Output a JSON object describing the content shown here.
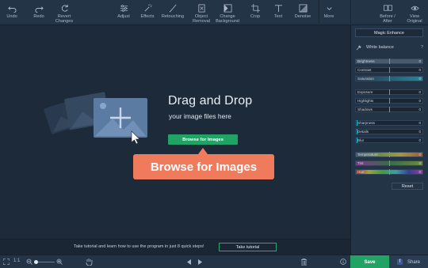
{
  "toolbar": {
    "undo": "Undo",
    "redo": "Redo",
    "revert_line1": "Revert",
    "revert_line2": "Changes",
    "adjust": "Adjust",
    "effects": "Effects",
    "retouching": "Retouching",
    "object_line1": "Object",
    "object_line2": "Removal",
    "change_line1": "Change",
    "change_line2": "Background",
    "crop": "Crop",
    "text": "Text",
    "denoise": "Denoise",
    "more": "More",
    "before_line1": "Before /",
    "before_line2": "After",
    "view_line1": "View",
    "view_line2": "Original"
  },
  "canvas": {
    "title": "Drag and Drop",
    "subtitle": "your image files here",
    "browse_button": "Browse for Images",
    "callout": "Browse for Images"
  },
  "tutorial": {
    "text": "Take tutorial and learn how to use the program in just 8 quick steps!",
    "button": "Take tutorial"
  },
  "bottombar": {
    "zoom_label": "1:1",
    "save": "Save",
    "share": "Share"
  },
  "panel": {
    "magic_enhance": "Magic Enhance",
    "white_balance": "White balance",
    "help": "?",
    "reset": "Reset",
    "sliders": [
      {
        "label": "Brightness",
        "value": "0"
      },
      {
        "label": "Contrast",
        "value": "0"
      },
      {
        "label": "Saturation",
        "value": "0"
      },
      {
        "label": "Exposure",
        "value": "0"
      },
      {
        "label": "Highlights",
        "value": "0"
      },
      {
        "label": "Shadows",
        "value": "0"
      },
      {
        "label": "Sharpness",
        "value": "0"
      },
      {
        "label": "Details",
        "value": "0"
      },
      {
        "label": "Blur",
        "value": "0"
      },
      {
        "label": "Temperature",
        "value": "0"
      },
      {
        "label": "Tint",
        "value": "0"
      },
      {
        "label": "Hue",
        "value": "0"
      }
    ]
  },
  "colors": {
    "accent_green": "#21a366",
    "callout": "#f07a5c",
    "slider_thumb": "#20b9d4"
  }
}
